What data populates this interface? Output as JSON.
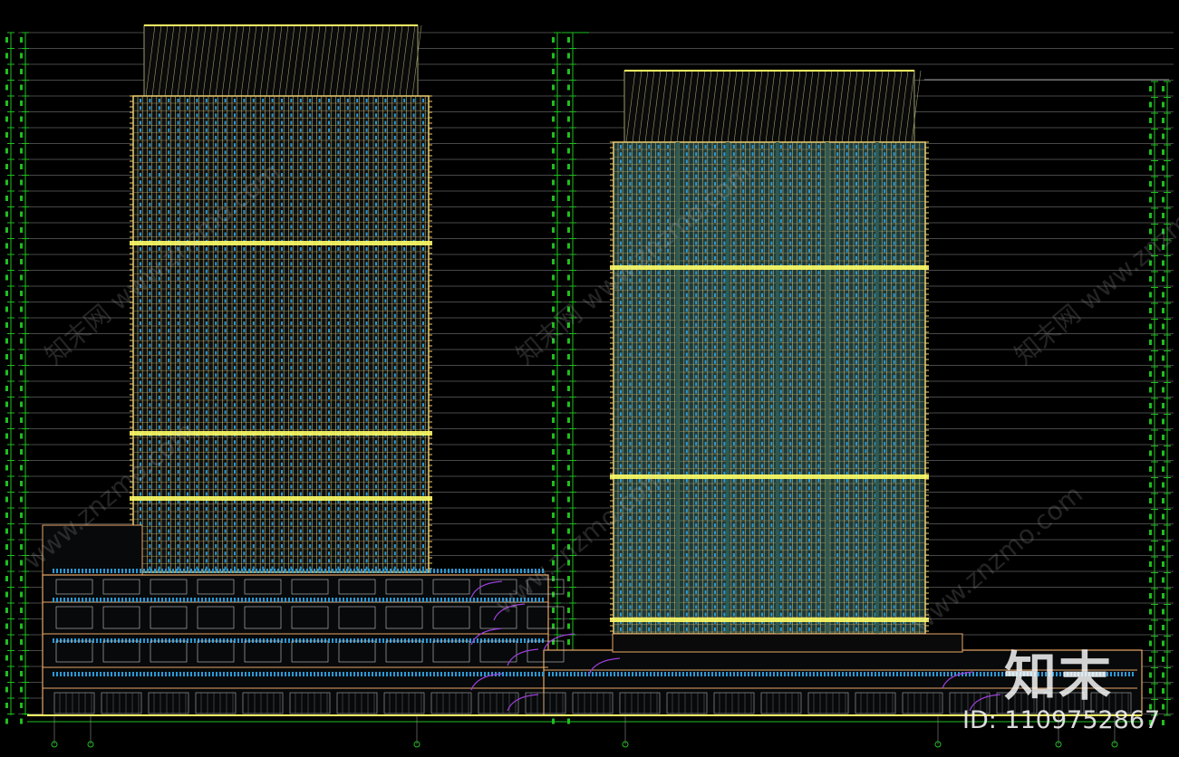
{
  "drawing": {
    "palette": {
      "background": "#000000",
      "dimension": "#1fbf1f",
      "frame": "#f0d070",
      "facade_mesh": "#c8b068",
      "glazing": "#2a9ad8",
      "band": "#ffff66",
      "roof_hatch": "#9c9c6c",
      "tower_fill": "#1c3a3a",
      "podium": "#e8a868",
      "awning": "#9b3fd8",
      "level_line": "#8f8f8f"
    }
  },
  "watermark": {
    "logo": "知末",
    "id_text": "ID: 1109752867",
    "site": "www.znzmo.com",
    "site_cn": "知末网"
  }
}
